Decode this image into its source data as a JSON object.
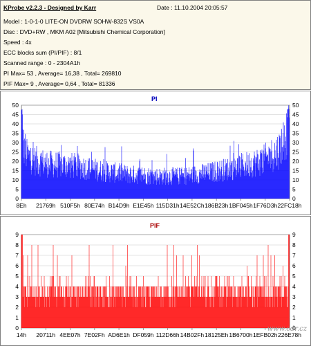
{
  "info": {
    "title": "KProbe v2.2.3 - Designed by Karr",
    "date": "Date : 11.10.2004 20:05:57",
    "lines": [
      "Model : 1-0-1-0 LITE-ON DVDRW SOHW-832S  VS0A",
      "Disc : DVD+RW , MKM A02 [Mitsubishi Chemical Corporation]",
      "Speed : 4x",
      "ECC blocks sum (PI/PIF) : 8/1",
      "Scanned range : 0 - 2304A1h",
      "PI Max= 53 , Average= 16,38 , Total= 269810",
      "PIF Max= 9 , Average= 0,64 , Total= 81336"
    ]
  },
  "watermark": "www.cdr.cz",
  "chart_data": [
    {
      "type": "bar",
      "title": "PI",
      "color": "#0000ff",
      "ylim": [
        0,
        50
      ],
      "yticks": [
        0,
        5,
        10,
        15,
        20,
        25,
        30,
        35,
        40,
        45,
        50
      ],
      "xticklabels": [
        "8Eh",
        "21769h",
        "510F5h",
        "80E74h",
        "B14D9h",
        "E1E45h",
        "115D31h",
        "14E52Ch",
        "186B23h",
        "1BF045h",
        "1F76D3h",
        "22FC18h"
      ],
      "max": 53,
      "average": 16.38,
      "profile": [
        {
          "x": 0.0,
          "y": 35
        },
        {
          "x": 0.02,
          "y": 25
        },
        {
          "x": 0.05,
          "y": 22
        },
        {
          "x": 0.1,
          "y": 20
        },
        {
          "x": 0.2,
          "y": 19
        },
        {
          "x": 0.3,
          "y": 16
        },
        {
          "x": 0.4,
          "y": 14
        },
        {
          "x": 0.5,
          "y": 13
        },
        {
          "x": 0.6,
          "y": 13
        },
        {
          "x": 0.7,
          "y": 15
        },
        {
          "x": 0.8,
          "y": 18
        },
        {
          "x": 0.9,
          "y": 22
        },
        {
          "x": 0.96,
          "y": 28
        },
        {
          "x": 1.0,
          "y": 42
        }
      ]
    },
    {
      "type": "bar",
      "title": "PIF",
      "color": "#ff0000",
      "ylim": [
        0,
        9
      ],
      "yticks": [
        0,
        1,
        2,
        3,
        4,
        5,
        6,
        7,
        8,
        9
      ],
      "xticklabels": [
        "14h",
        "20711h",
        "4EE07h",
        "7E02Fh",
        "AD6E1h",
        "DF059h",
        "112D66h",
        "14B02Fh",
        "18125Eh",
        "1B6700h",
        "1EFB02h",
        "226E78h"
      ],
      "max": 9,
      "average": 0.64
    }
  ]
}
